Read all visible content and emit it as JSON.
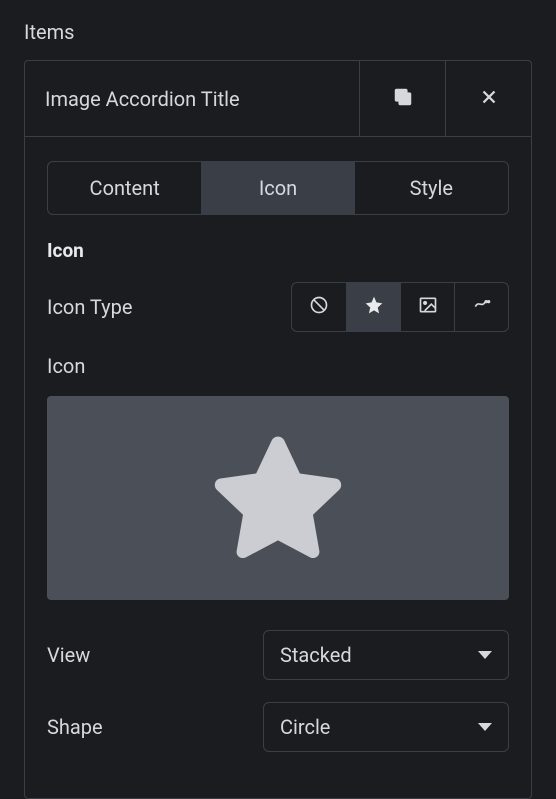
{
  "section_title": "Items",
  "accordion": {
    "title": "Image Accordion Title"
  },
  "tabs": {
    "content": "Content",
    "icon": "Icon",
    "style": "Style"
  },
  "subsection": {
    "title": "Icon",
    "icon_type_label": "Icon Type",
    "icon_label": "Icon",
    "view_label": "View",
    "shape_label": "Shape"
  },
  "selects": {
    "view": "Stacked",
    "shape": "Circle"
  }
}
